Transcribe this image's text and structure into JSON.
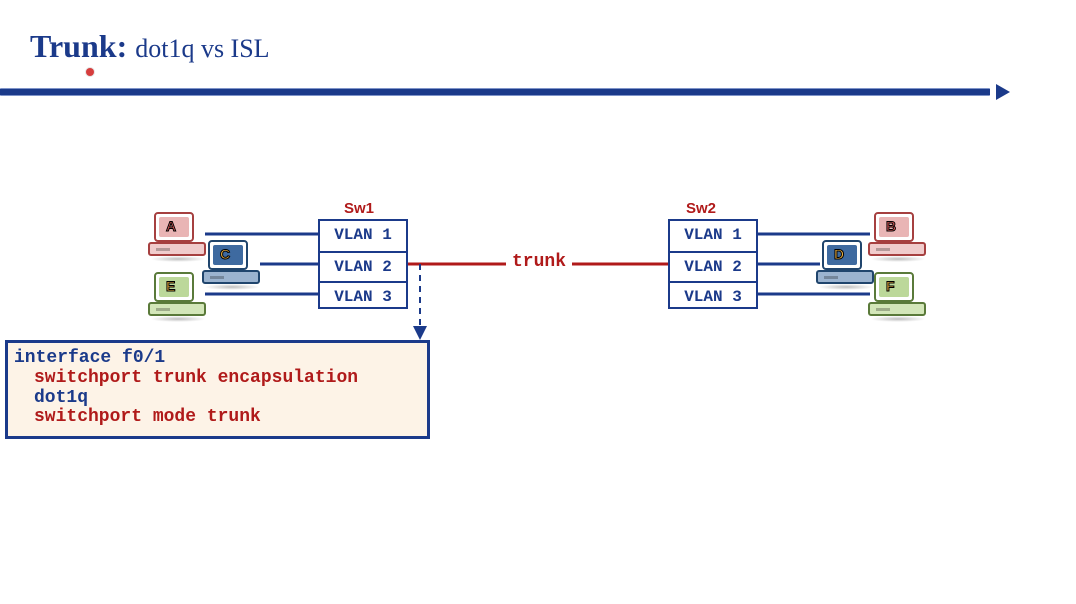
{
  "title": {
    "main": "Trunk:",
    "sub": "dot1q vs ISL"
  },
  "switches": {
    "sw1": {
      "label": "Sw1",
      "vlans": [
        "VLAN 1",
        "VLAN 2",
        "VLAN 3"
      ]
    },
    "sw2": {
      "label": "Sw2",
      "vlans": [
        "VLAN 1",
        "VLAN 2",
        "VLAN 3"
      ]
    }
  },
  "trunk": {
    "label": "trunk"
  },
  "hosts": {
    "a": {
      "letter": "A",
      "color": "red"
    },
    "b": {
      "letter": "B",
      "color": "red"
    },
    "c": {
      "letter": "C",
      "color": "blue"
    },
    "d": {
      "letter": "D",
      "color": "blue"
    },
    "e": {
      "letter": "E",
      "color": "green"
    },
    "f": {
      "letter": "F",
      "color": "green"
    }
  },
  "cli": {
    "line1": "interface f0/1",
    "line2_cmd": "switchport trunk encapsulation ",
    "line2_kw": "dot1q",
    "line3": "switchport mode trunk"
  },
  "colors": {
    "accent": "#1b3a8a",
    "danger": "#b01a1a",
    "codebg": "#fdf3e7",
    "host_red_border": "#a64040",
    "host_red_fill": "#e9b5b5",
    "host_red_letter": "#e05a5a",
    "host_blue_border": "#20456d",
    "host_blue_fill": "#3e6aa0",
    "host_blue_letter": "#f5b642",
    "host_green_border": "#5a7a3a",
    "host_green_fill": "#bcd89a",
    "host_green_letter": "#f5b642"
  }
}
